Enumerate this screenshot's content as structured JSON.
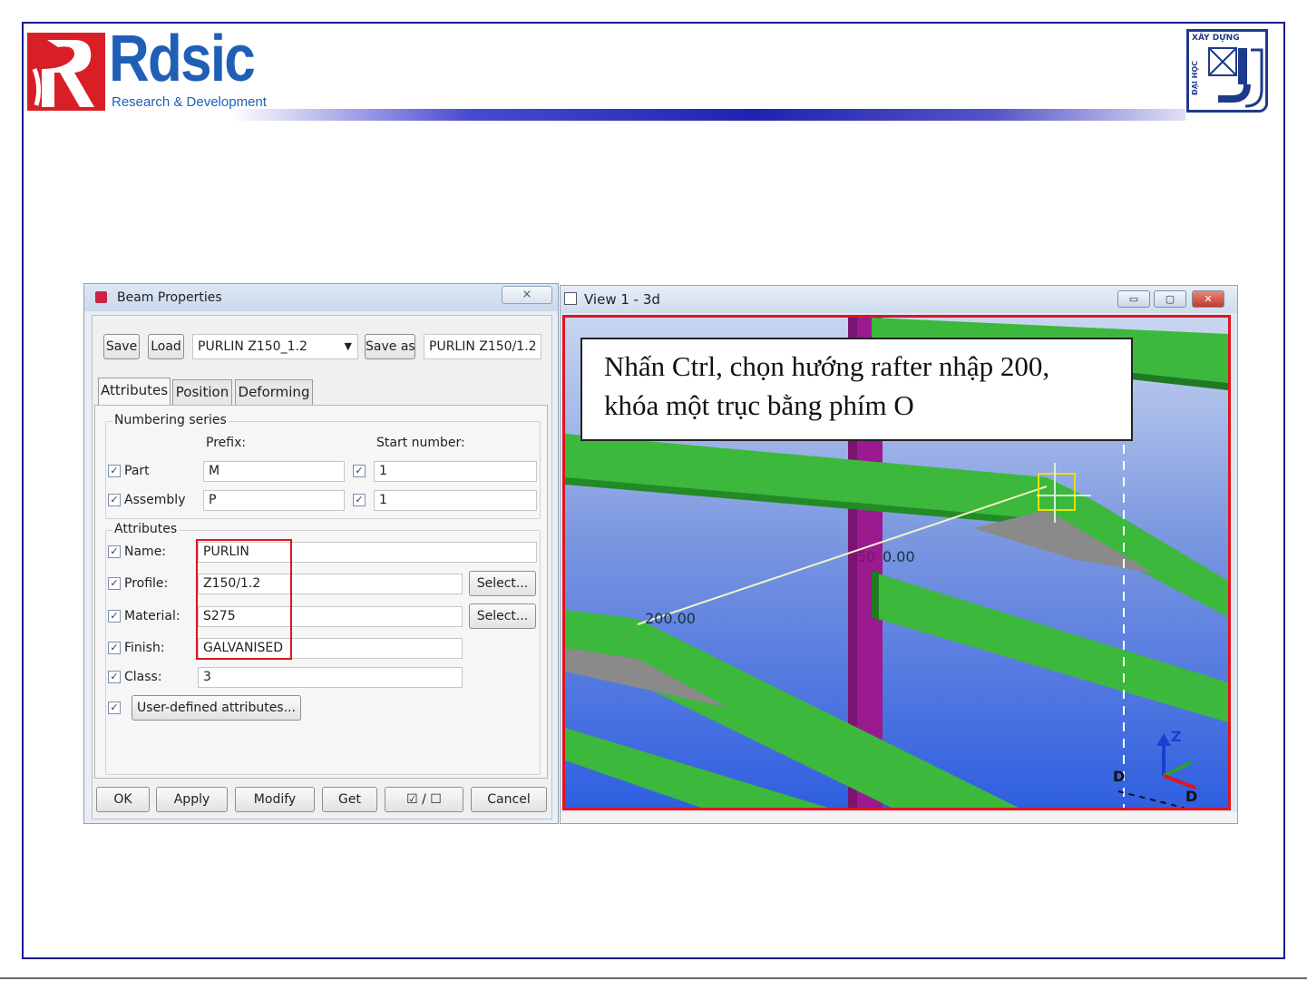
{
  "header": {
    "brand_name": "Rdsic",
    "brand_tagline": "Research & Development",
    "university_logo_text_top": "XÂY DỰNG",
    "university_logo_text_side": "ĐẠI HỌC"
  },
  "dialog": {
    "title": "Beam Properties",
    "close_glyph": "⨯",
    "toolbar": {
      "save": "Save",
      "load": "Load",
      "preset_value": "PURLIN Z150_1.2",
      "save_as": "Save as",
      "save_as_value": "PURLIN Z150/1.2"
    },
    "tabs": [
      "Attributes",
      "Position",
      "Deforming"
    ],
    "numbering": {
      "group_title": "Numbering series",
      "prefix_header": "Prefix:",
      "start_header": "Start number:",
      "rows": [
        {
          "label": "Part",
          "prefix": "M",
          "start": "1"
        },
        {
          "label": "Assembly",
          "prefix": "P",
          "start": "1"
        }
      ]
    },
    "attributes": {
      "group_title": "Attributes",
      "name_label": "Name:",
      "name_value": "PURLIN",
      "profile_label": "Profile:",
      "profile_value": "Z150/1.2",
      "material_label": "Material:",
      "material_value": "S275",
      "finish_label": "Finish:",
      "finish_value": "GALVANISED",
      "class_label": "Class:",
      "class_value": "3",
      "select_label": "Select...",
      "user_defined": "User-defined attributes..."
    },
    "footer": {
      "ok": "OK",
      "apply": "Apply",
      "modify": "Modify",
      "get": "Get",
      "toggle": "☑ / ☐",
      "cancel": "Cancel"
    }
  },
  "view": {
    "title": "View 1 - 3d",
    "callout_line1": "Nhấn Ctrl, chọn hướng rafter nhập 200,",
    "callout_line2": "khóa một trục bằng phím O",
    "dim_upper": "0.00",
    "dim_upper_partial": "50",
    "dim_lower": "200.00",
    "axis_z": "Z",
    "axis_d1": "D",
    "axis_d2": "D",
    "colors": {
      "beam": "#3cb83c",
      "column": "#9b1a8f",
      "highlight": "#e0141c"
    }
  }
}
